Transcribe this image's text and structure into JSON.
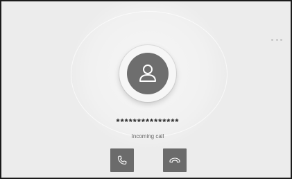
{
  "screen": {
    "more_icon": "more-horizontal-icon",
    "caller": {
      "avatar_icon": "person-icon",
      "number": "***************",
      "status": "Incoming call"
    },
    "actions": {
      "accept_icon": "phone-icon",
      "decline_icon": "phone-hangup-icon"
    },
    "colors": {
      "background": "#ececec",
      "button": "#6b6b6b",
      "avatar": "#6e6e6e"
    }
  }
}
